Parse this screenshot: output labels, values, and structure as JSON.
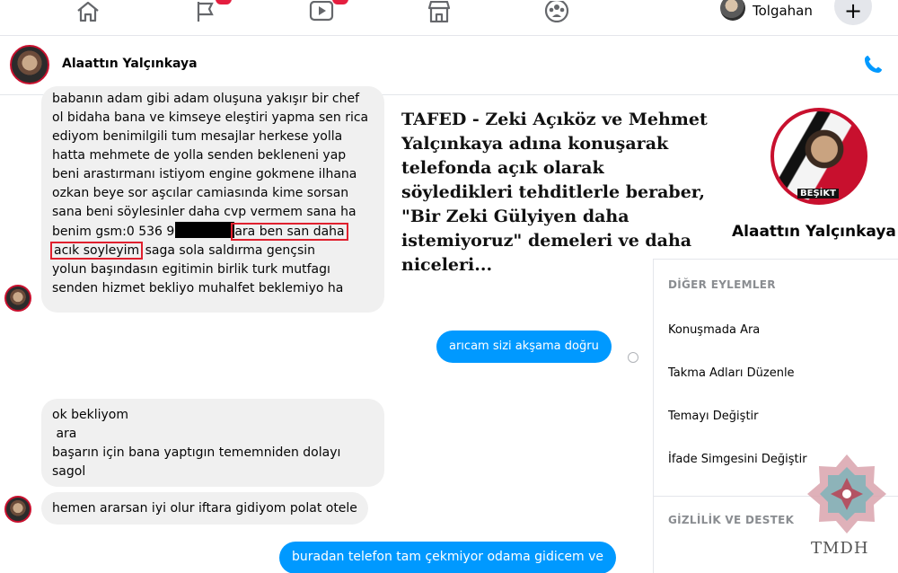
{
  "profile": {
    "name": "Tolgahan"
  },
  "header": {
    "contact_name": "Alaattın Yalçınkaya"
  },
  "messages": {
    "first": {
      "lines": [
        "babanın adam gibi adam oluşuna yakışır bir chef",
        "ol bidaha bana ve kimseye eleştiri yapma sen rica",
        "ediyom benimilgili tum mesajlar herkese yolla",
        "hatta mehmete de yolla senden bekleneni yap",
        "beni arastırmanı istiyom engine gokmene ilhana",
        "ozkan beye sor aşcılar camiasında kime sorsan",
        "sana beni söylesinler daha cvp vermem sana ha"
      ],
      "gsm_prefix": "benim gsm:0 536 9",
      "gsm_highlight": "ara ben san daha",
      "highlight2": "acık soyleyim",
      "after_highlight": " saga sola saldırma gençsin",
      "tail_lines": [
        "yolun başındasın egitimin birlik turk mutfagı",
        "senden hizmet bekliyo muhalfet beklemiyo ha"
      ]
    },
    "out1": "arıcam sizi akşama doğru",
    "second": {
      "lines": [
        "ok bekliyom",
        " ara",
        "başarın için bana yaptıgın tememniden dolayı",
        "sagol"
      ]
    },
    "third": "hemen ararsan iyi olur iftara gidiyom polat otele",
    "out2": "buradan telefon tam çekmiyor odama gidicem ve"
  },
  "caption": {
    "lines": [
      "TAFED - Zeki Açıköz ve Mehmet",
      "Yalçınkaya adına konuşarak",
      "telefonda açık olarak",
      "söyledikleri tehditlerle beraber,",
      "\"Bir Zeki Gülyiyen daha",
      "istemiyoruz\" demeleri ve daha",
      "niceleri..."
    ]
  },
  "sidebar": {
    "name": "Alaattın Yalçınkaya",
    "avatar_tag": "BEŞİKT",
    "other_actions_heading": "DİĞER EYLEMLER",
    "items": [
      "Konuşmada Ara",
      "Takma Adları Düzenle",
      "Temayı Değiştir",
      "İfade Simgesini Değiştir"
    ],
    "privacy_heading": "GİZLİLİK VE DESTEK"
  },
  "watermark": {
    "text": "TMDH"
  },
  "colors": {
    "brand_blue": "#0099ff",
    "highlight_red": "#e0202e",
    "bubble_gray": "#f0f0f0"
  }
}
